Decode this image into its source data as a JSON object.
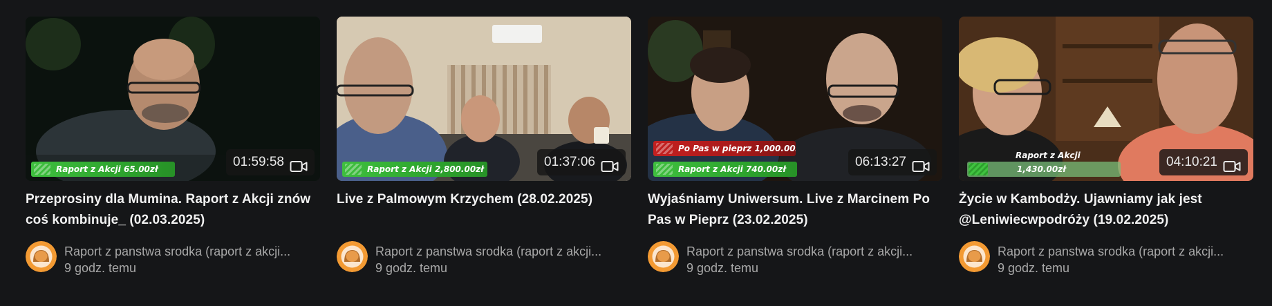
{
  "videos": [
    {
      "title": "Przeprosiny dla Mumina. Raport z Akcji znów coś kombinuje_ (02.03.2025)",
      "duration": "01:59:58",
      "duration_icon": "video-camera-icon",
      "banners": [
        {
          "text": "Raport z Akcji 65.00zł",
          "style": "green"
        }
      ],
      "channel": "Raport z panstwa srodka (raport z akcji...",
      "age": "9 godz. temu",
      "thumbnail_colors": {
        "bg": "#0c1410",
        "accent": "#2c3a2a"
      }
    },
    {
      "title": "Live z Palmowym Krzychem (28.02.2025)",
      "duration": "01:37:06",
      "duration_icon": "video-camera-icon",
      "banners": [
        {
          "text": "Raport z Akcji 2,800.00zł",
          "style": "green"
        }
      ],
      "channel": "Raport z panstwa srodka (raport z akcji...",
      "age": "9 godz. temu",
      "thumbnail_colors": {
        "bg": "#d9ccb6",
        "accent": "#3a4f7a"
      }
    },
    {
      "title": "Wyjaśniamy Uniwersum. Live z Marcinem Po Pas w Pieprz (23.02.2025)",
      "duration": "06:13:27",
      "duration_icon": "video-camera-icon",
      "banners": [
        {
          "text": "Po Pas w pieprz 1,000.00zł",
          "style": "red"
        },
        {
          "text": "Raport z Akcji 740.00zł",
          "style": "green"
        }
      ],
      "channel": "Raport z panstwa srodka (raport z akcji...",
      "age": "9 godz. temu",
      "thumbnail_colors": {
        "bg": "#2a2018",
        "accent": "#1e2a3a"
      }
    },
    {
      "title": "Życie w Kambodży. Ujawniamy jak jest @Leniwiecwpodróży (19.02.2025)",
      "duration": "04:10:21",
      "duration_icon": "video-camera-icon",
      "banners": [
        {
          "text": "Raport z Akcji",
          "style": "label"
        },
        {
          "text": "1,430.00zł",
          "style": "pale"
        }
      ],
      "channel": "Raport z panstwa srodka (raport z akcji...",
      "age": "9 godz. temu",
      "thumbnail_colors": {
        "bg": "#5a3a22",
        "accent": "#e07a5f"
      }
    }
  ],
  "colors": {
    "background": "#151618",
    "title_text": "#f1f1f1",
    "meta_text": "#a8a8a8",
    "avatar_orange": "#f39a33",
    "banner_green": "#3fbf3f",
    "banner_red": "#c32020"
  },
  "avatar_icon": "channel-avatar-icon"
}
